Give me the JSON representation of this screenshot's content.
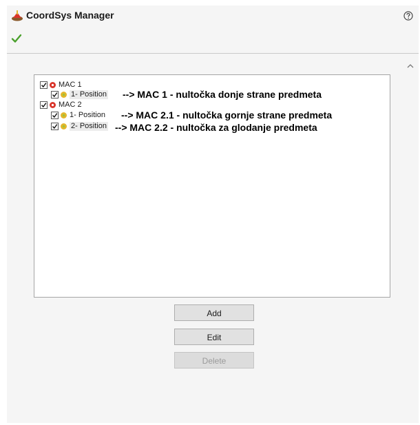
{
  "header": {
    "title": "CoordSys Manager",
    "app_icon": "coordsys-icon",
    "help_icon": "help-icon",
    "ok_icon": "check-icon"
  },
  "tree": {
    "items": [
      {
        "label": "MAC 1",
        "checked": true,
        "icon": "machine-icon"
      },
      {
        "label": "1- Position",
        "checked": true,
        "icon": "position-icon",
        "annotation": "--> MAC 1 - nultočka donje strane predmeta"
      },
      {
        "label": "MAC 2",
        "checked": true,
        "icon": "machine-icon"
      },
      {
        "label": "1- Position",
        "checked": true,
        "icon": "position-icon",
        "annotation": "--> MAC 2.1 - nultočka gornje strane predmeta"
      },
      {
        "label": "2- Position",
        "checked": true,
        "icon": "position-icon",
        "annotation": "--> MAC 2.2 - nultočka za glodanje predmeta"
      }
    ]
  },
  "buttons": {
    "add_label": "Add",
    "edit_label": "Edit",
    "delete_label": "Delete",
    "delete_enabled": false
  },
  "colors": {
    "panel_bg": "#f5f5f5",
    "ok_green": "#4aa02c",
    "machine_red": "#d9362b",
    "position_yellow": "#e3b62b"
  }
}
